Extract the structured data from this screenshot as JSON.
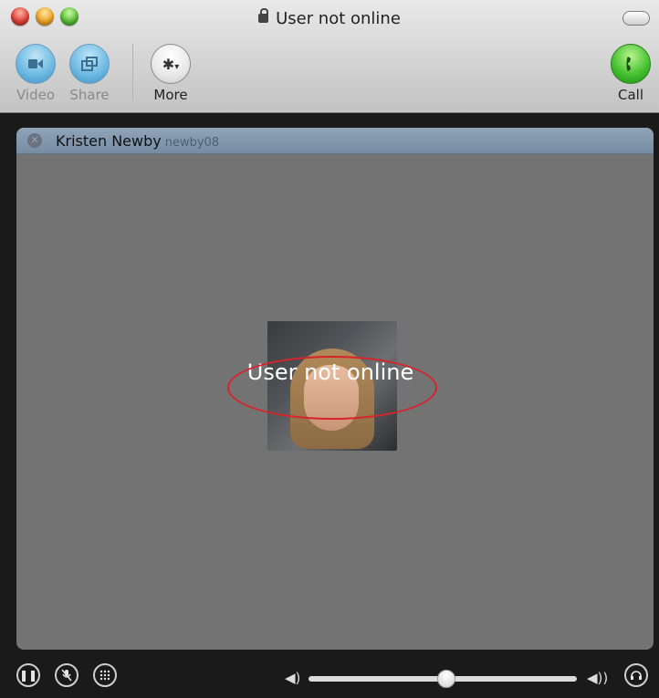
{
  "window": {
    "title": "User not online"
  },
  "toolbar": {
    "video_label": "Video",
    "share_label": "Share",
    "more_label": "More",
    "call_label": "Call"
  },
  "contact": {
    "name": "Kristen Newby",
    "username": "newby08"
  },
  "overlay": {
    "status_text": "User not online"
  },
  "volume": {
    "level": 0.51
  },
  "icons": [
    "close-icon",
    "minimize-icon",
    "zoom-icon",
    "lock-icon",
    "video-icon",
    "share-icon",
    "gear-icon",
    "phone-icon",
    "offline-status-icon",
    "pause-icon",
    "mute-mic-icon",
    "dialpad-icon",
    "volume-low-icon",
    "volume-high-icon",
    "headset-icon"
  ],
  "colors": {
    "toolbar_bg": "#d2d2d2",
    "panel_bg": "#737373",
    "contact_bar": "#8fa4b8",
    "highlight_ring": "#d8232a"
  }
}
